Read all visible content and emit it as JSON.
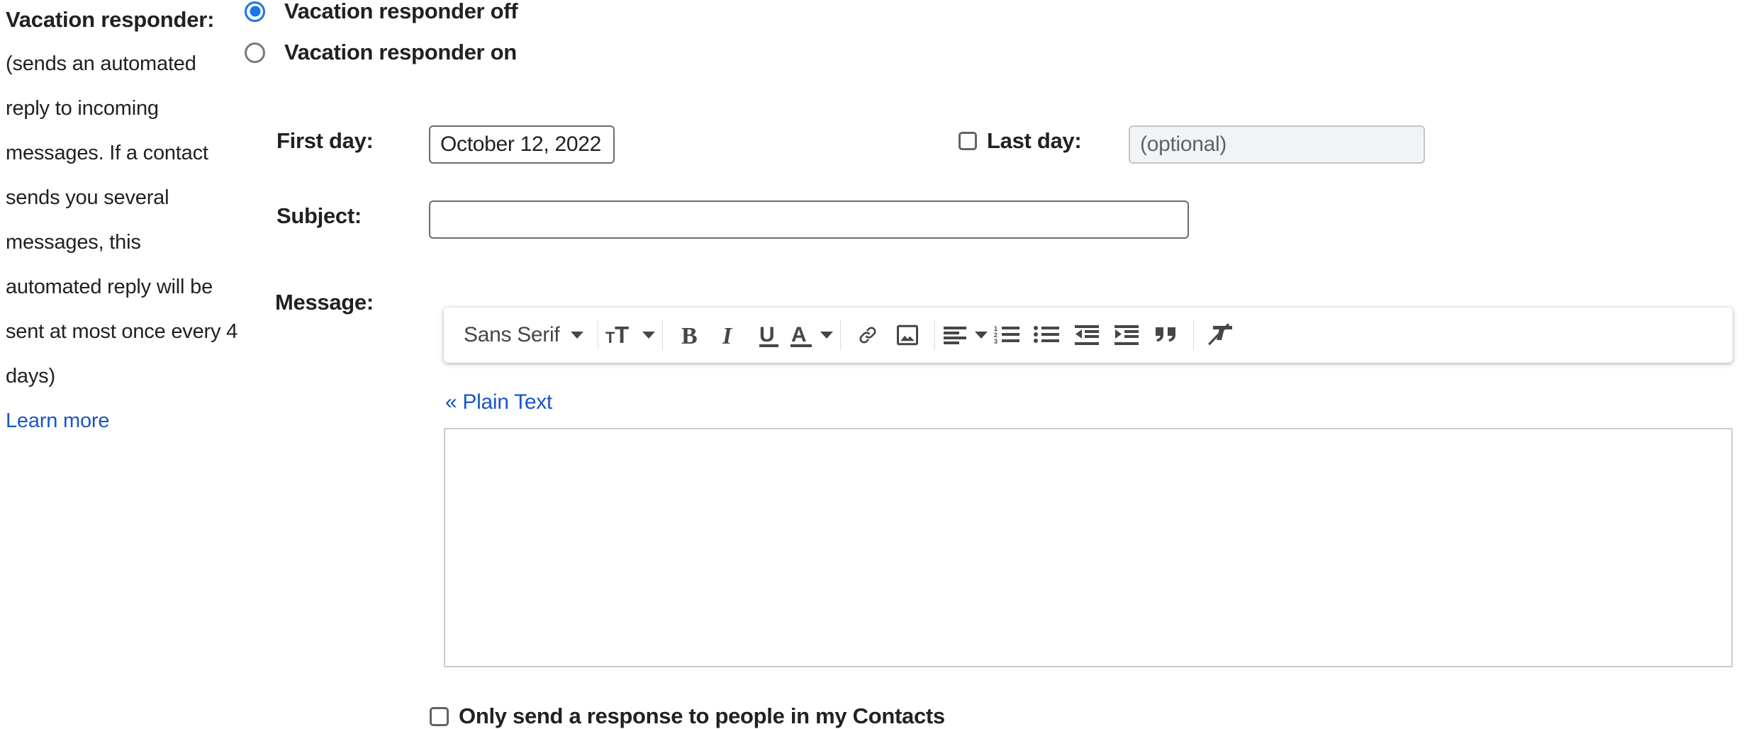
{
  "sidebar": {
    "title": "Vacation responder:",
    "note": "(sends an automated reply to incoming messages. If a contact sends you several messages, this automated reply will be sent at most once every 4 days)",
    "learn_more": "Learn more"
  },
  "responder": {
    "off_label": "Vacation responder off",
    "on_label": "Vacation responder on",
    "selected": "off"
  },
  "fields": {
    "first_day_label": "First day:",
    "first_day_value": "October 12, 2022",
    "last_day_label": "Last day:",
    "last_day_placeholder": "(optional)",
    "last_day_value": "",
    "last_day_enabled": false,
    "subject_label": "Subject:",
    "subject_value": "",
    "message_label": "Message:",
    "message_body_value": ""
  },
  "toolbar": {
    "font_name": "Sans Serif",
    "items": [
      {
        "name": "font-family-selector",
        "label": "Sans Serif"
      },
      {
        "name": "font-size-button",
        "label": "Size"
      },
      {
        "name": "bold-button",
        "label": "B"
      },
      {
        "name": "italic-button",
        "label": "I"
      },
      {
        "name": "underline-button",
        "label": "U"
      },
      {
        "name": "text-color-button",
        "label": "A"
      },
      {
        "name": "insert-link-button",
        "label": "Link"
      },
      {
        "name": "insert-image-button",
        "label": "Insert image"
      },
      {
        "name": "align-button",
        "label": "Align"
      },
      {
        "name": "numbered-list-button",
        "label": "Numbered list"
      },
      {
        "name": "bulleted-list-button",
        "label": "Bulleted list"
      },
      {
        "name": "indent-less-button",
        "label": "Indent less"
      },
      {
        "name": "indent-more-button",
        "label": "Indent more"
      },
      {
        "name": "quote-button",
        "label": "Quote"
      },
      {
        "name": "remove-formatting-button",
        "label": "Remove formatting"
      }
    ]
  },
  "links": {
    "plain_text": "« Plain Text"
  },
  "contacts_option": {
    "label": "Only send a response to people in my Contacts"
  },
  "colors": {
    "accent": "#1a73e8",
    "link": "#1a56c4",
    "text": "#202124",
    "icon": "#444746",
    "border": "#6b6b6b",
    "disabled_bg": "#f1f3f4"
  }
}
